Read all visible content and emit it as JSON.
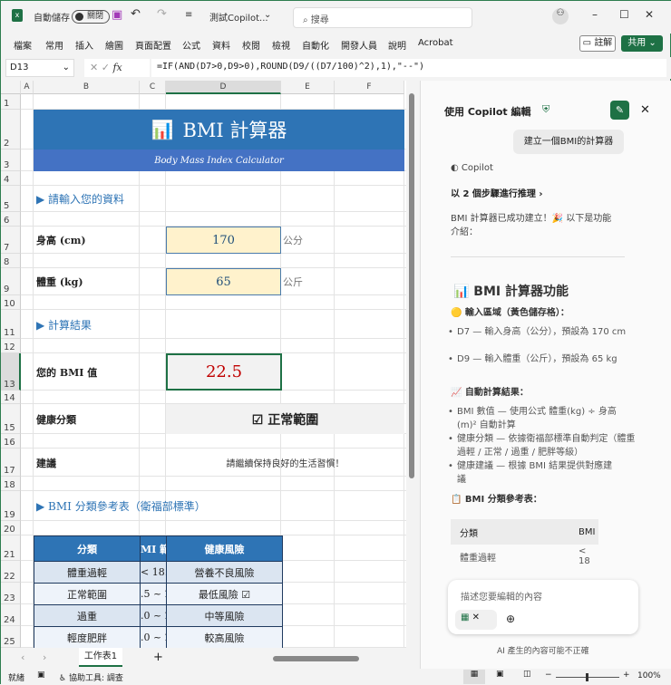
{
  "window": {
    "autosave_label": "自動儲存",
    "autosave_state": "關閉",
    "doc_title": "測試Copilot...",
    "search_placeholder": "搜尋"
  },
  "ribbon": {
    "tabs": [
      "檔案",
      "常用",
      "插入",
      "繪圖",
      "頁面配置",
      "公式",
      "資料",
      "校閱",
      "檢視",
      "自動化",
      "開發人員",
      "說明",
      "Acrobat"
    ],
    "comments_label": "註解",
    "share_label": "共用"
  },
  "formula_bar": {
    "name_box": "D13",
    "formula": "=IF(AND(D7>0,D9>0),ROUND(D9/((D7/100)^2),1),\"--\")"
  },
  "grid": {
    "columns": [
      "A",
      "B",
      "C",
      "D",
      "E",
      "F"
    ],
    "rows": [
      "1",
      "2",
      "3",
      "4",
      "5",
      "6",
      "7",
      "8",
      "9",
      "10",
      "11",
      "12",
      "13",
      "14",
      "15",
      "16",
      "17",
      "18",
      "19",
      "20",
      "21",
      "22",
      "23",
      "24",
      "25"
    ]
  },
  "sheet": {
    "title": "BMI 計算器",
    "subtitle": "Body Mass Index Calculator",
    "section_input": "▶ 請輸入您的資料",
    "height_label": "身高 (cm)",
    "height_value": "170",
    "height_unit": "公分",
    "weight_label": "體重 (kg)",
    "weight_value": "65",
    "weight_unit": "公斤",
    "section_result": "▶ 計算結果",
    "bmi_label": "您的 BMI 值",
    "bmi_value": "22.5",
    "category_label": "健康分類",
    "category_value": "☑ 正常範圍",
    "advice_label": "建議",
    "advice_value": "請繼續保持良好的生活習慣！",
    "section_ref": "▶ BMI 分類參考表（衛福部標準）",
    "ref_headers": [
      "分類",
      "MI 範",
      "健康風險"
    ],
    "ref_rows": [
      [
        "體重過輕",
        "< 18.5",
        "營養不良風險"
      ],
      [
        "正常範圍",
        ".5 ~ 2:",
        "最低風險 ☑"
      ],
      [
        "過重",
        ".0 ~ 2(",
        "中等風險"
      ],
      [
        "輕度肥胖",
        ".0 ~ 2(",
        "較高風險"
      ]
    ],
    "accent": "#2e74b5"
  },
  "sheet_tabs": {
    "active": "工作表1"
  },
  "status": {
    "ready": "就緒",
    "accessibility": "協助工具: 調查",
    "zoom": "100%"
  },
  "copilot": {
    "title": "使用 Copilot 編輯",
    "user_prompt": "建立一個BMI的計算器",
    "assistant_name": "Copilot",
    "reasoning": "以 2 個步驟進行推理 ›",
    "intro": "BMI 計算器已成功建立！🎉 以下是功能介紹：",
    "heading": "📊 BMI 計算器功能",
    "input_heading": "🟡 輸入區域（黃色儲存格）：",
    "input_items": [
      "D7 — 輸入身高（公分），預設為 170 cm",
      "D9 — 輸入體重（公斤），預設為 65 kg"
    ],
    "auto_heading": "📈 自動計算結果：",
    "auto_items": [
      "BMI 數值 — 使用公式 體重(kg) ÷ 身高(m)² 自動計算",
      "健康分類 — 依據衛福部標準自動判定（體重過輕 / 正常 / 過重 / 肥胖等級）",
      "健康建議 — 根據 BMI 結果提供對應建議"
    ],
    "table_heading": "📋 BMI 分類參考表：",
    "table_headers": [
      "分類",
      "BMI"
    ],
    "table_row": [
      "體重過輕",
      "< 18"
    ],
    "input_placeholder": "描述您要編輯的內容",
    "disclaimer": "AI 產生的內容可能不正確"
  }
}
